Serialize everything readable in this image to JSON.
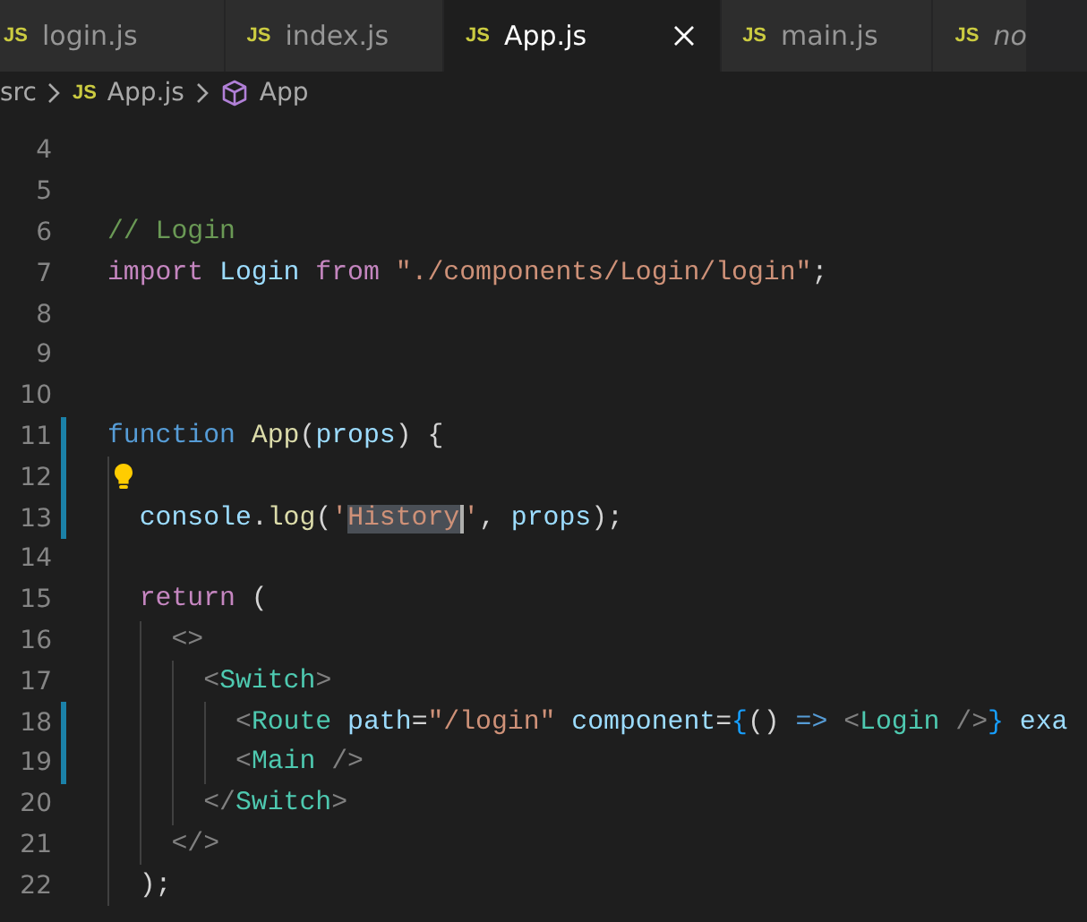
{
  "tabs": [
    {
      "icon": "JS",
      "label": "login.js",
      "selected": false,
      "preview": false,
      "closable": false
    },
    {
      "icon": "JS",
      "label": "index.js",
      "selected": false,
      "preview": false,
      "closable": false
    },
    {
      "icon": "JS",
      "label": "App.js",
      "selected": true,
      "preview": false,
      "closable": true
    },
    {
      "icon": "JS",
      "label": "main.js",
      "selected": false,
      "preview": false,
      "closable": false
    },
    {
      "icon": "JS",
      "label": "no",
      "selected": false,
      "preview": true,
      "closable": false
    }
  ],
  "breadcrumb": [
    {
      "kind": "folder",
      "text": "src"
    },
    {
      "kind": "file",
      "icon": "JS",
      "text": "App.js"
    },
    {
      "kind": "symbol",
      "text": "App"
    }
  ],
  "lines": [
    {
      "number": "4",
      "modified": false,
      "lightbulb": false
    },
    {
      "number": "5",
      "modified": false,
      "lightbulb": false
    },
    {
      "number": "6",
      "modified": false,
      "lightbulb": false,
      "tokens": [
        {
          "kind": "comment",
          "text": "// Login"
        }
      ]
    },
    {
      "number": "7",
      "modified": false,
      "lightbulb": false,
      "tokens": [
        {
          "kind": "control",
          "text": "import"
        },
        {
          "kind": "variable",
          "text": " Login"
        },
        {
          "kind": "control",
          "text": " from"
        },
        {
          "kind": "string",
          "text": " \"./components/Login/login\""
        },
        {
          "kind": "plain",
          "text": ";"
        }
      ]
    },
    {
      "number": "8",
      "modified": false,
      "lightbulb": false
    },
    {
      "number": "9",
      "modified": false,
      "lightbulb": false
    },
    {
      "number": "10",
      "modified": false,
      "lightbulb": false
    },
    {
      "number": "11",
      "modified": true,
      "lightbulb": false,
      "tokens": [
        {
          "kind": "keyword",
          "text": "function"
        },
        {
          "kind": "function",
          "text": " App"
        },
        {
          "kind": "plain",
          "text": "("
        },
        {
          "kind": "variable",
          "text": "props"
        },
        {
          "kind": "plain",
          "text": ") {"
        }
      ]
    },
    {
      "number": "12",
      "modified": true,
      "lightbulb": true
    },
    {
      "number": "13",
      "modified": true,
      "lightbulb": false,
      "tokens": [
        {
          "kind": "variable",
          "text": "  console"
        },
        {
          "kind": "plain",
          "text": "."
        },
        {
          "kind": "function",
          "text": "log"
        },
        {
          "kind": "plain",
          "text": "("
        },
        {
          "kind": "string",
          "text": "'"
        },
        {
          "kind": "string-selected",
          "text": "History"
        },
        {
          "kind": "string",
          "text": "'"
        },
        {
          "kind": "plain",
          "text": ","
        },
        {
          "kind": "variable",
          "text": " props"
        },
        {
          "kind": "plain",
          "text": ");"
        }
      ]
    },
    {
      "number": "14",
      "modified": false,
      "lightbulb": false
    },
    {
      "number": "15",
      "modified": false,
      "lightbulb": false,
      "tokens": [
        {
          "kind": "control",
          "text": "  return"
        },
        {
          "kind": "plain",
          "text": " ("
        }
      ]
    },
    {
      "number": "16",
      "modified": false,
      "lightbulb": false,
      "tokens": [
        {
          "kind": "bracket",
          "text": "    <>"
        }
      ]
    },
    {
      "number": "17",
      "modified": false,
      "lightbulb": false,
      "tokens": [
        {
          "kind": "bracket",
          "text": "      <"
        },
        {
          "kind": "tag",
          "text": "Switch"
        },
        {
          "kind": "bracket",
          "text": ">"
        }
      ]
    },
    {
      "number": "18",
      "modified": true,
      "lightbulb": false,
      "tokens": [
        {
          "kind": "bracket",
          "text": "        <"
        },
        {
          "kind": "tag",
          "text": "Route"
        },
        {
          "kind": "variable",
          "text": " path"
        },
        {
          "kind": "plain",
          "text": "="
        },
        {
          "kind": "string",
          "text": "\"/login\""
        },
        {
          "kind": "variable",
          "text": " component"
        },
        {
          "kind": "plain",
          "text": "="
        },
        {
          "kind": "brace",
          "text": "{"
        },
        {
          "kind": "plain",
          "text": "()"
        },
        {
          "kind": "keyword",
          "text": " =>"
        },
        {
          "kind": "bracket",
          "text": " <"
        },
        {
          "kind": "tag",
          "text": "Login"
        },
        {
          "kind": "bracket",
          "text": " />"
        },
        {
          "kind": "brace",
          "text": "}"
        },
        {
          "kind": "variable",
          "text": " exa"
        }
      ]
    },
    {
      "number": "19",
      "modified": true,
      "lightbulb": false,
      "tokens": [
        {
          "kind": "bracket",
          "text": "        <"
        },
        {
          "kind": "tag",
          "text": "Main"
        },
        {
          "kind": "bracket",
          "text": " />"
        }
      ]
    },
    {
      "number": "20",
      "modified": false,
      "lightbulb": false,
      "tokens": [
        {
          "kind": "bracket",
          "text": "      </"
        },
        {
          "kind": "tag",
          "text": "Switch"
        },
        {
          "kind": "bracket",
          "text": ">"
        }
      ]
    },
    {
      "number": "21",
      "modified": false,
      "lightbulb": false,
      "tokens": [
        {
          "kind": "bracket",
          "text": "    </>"
        }
      ]
    },
    {
      "number": "22",
      "modified": false,
      "lightbulb": false,
      "tokens": [
        {
          "kind": "plain",
          "text": "  );"
        }
      ]
    }
  ]
}
